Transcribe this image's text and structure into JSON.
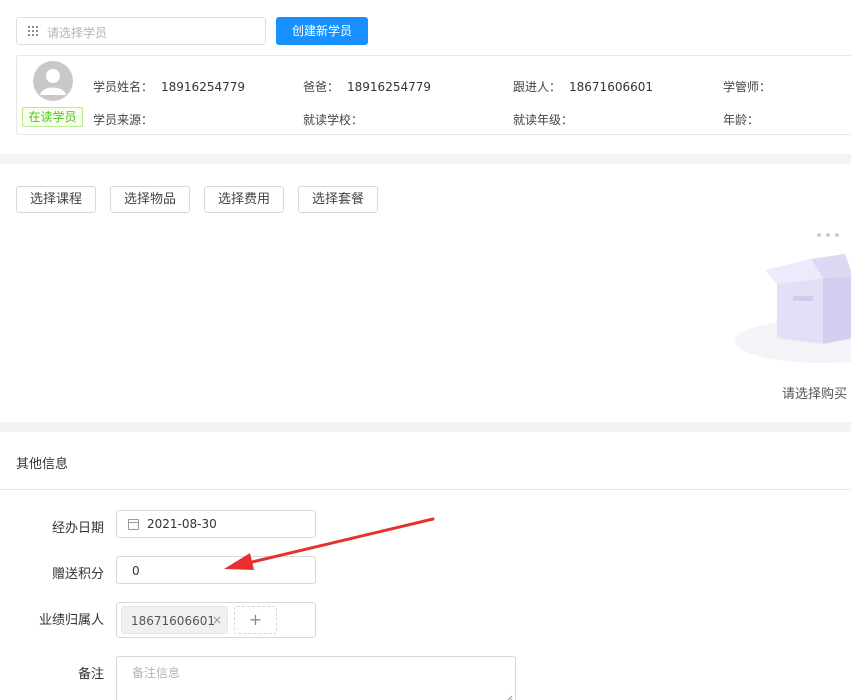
{
  "top": {
    "search_placeholder": "请选择学员",
    "create_button": "创建新学员",
    "status_tag": "在读学员",
    "fields": {
      "name_label": "学员姓名：",
      "name_value": "18916254779",
      "dad_label": "爸爸：",
      "dad_value": "18916254779",
      "follow_label": "跟进人：",
      "follow_value": "18671606601",
      "manager_label": "学管师：",
      "source_label": "学员来源：",
      "school_label": "就读学校：",
      "grade_label": "就读年级：",
      "age_label": "年龄："
    }
  },
  "purchase": {
    "buttons": [
      "选择课程",
      "选择物品",
      "选择费用",
      "选择套餐"
    ],
    "empty_text": "请选择购买"
  },
  "other": {
    "title": "其他信息",
    "date_label": "经办日期",
    "date_value": "2021-08-30",
    "points_label": "赠送积分",
    "points_value": "0",
    "owner_label": "业绩归属人",
    "owner_tag": "18671606601",
    "owner_remove": "×",
    "owner_add": "+",
    "remark_label": "备注",
    "remark_placeholder": "备注信息"
  },
  "colors": {
    "primary": "#1890ff",
    "status_green": "#52c41a",
    "annotation_red": "#e8312f"
  }
}
